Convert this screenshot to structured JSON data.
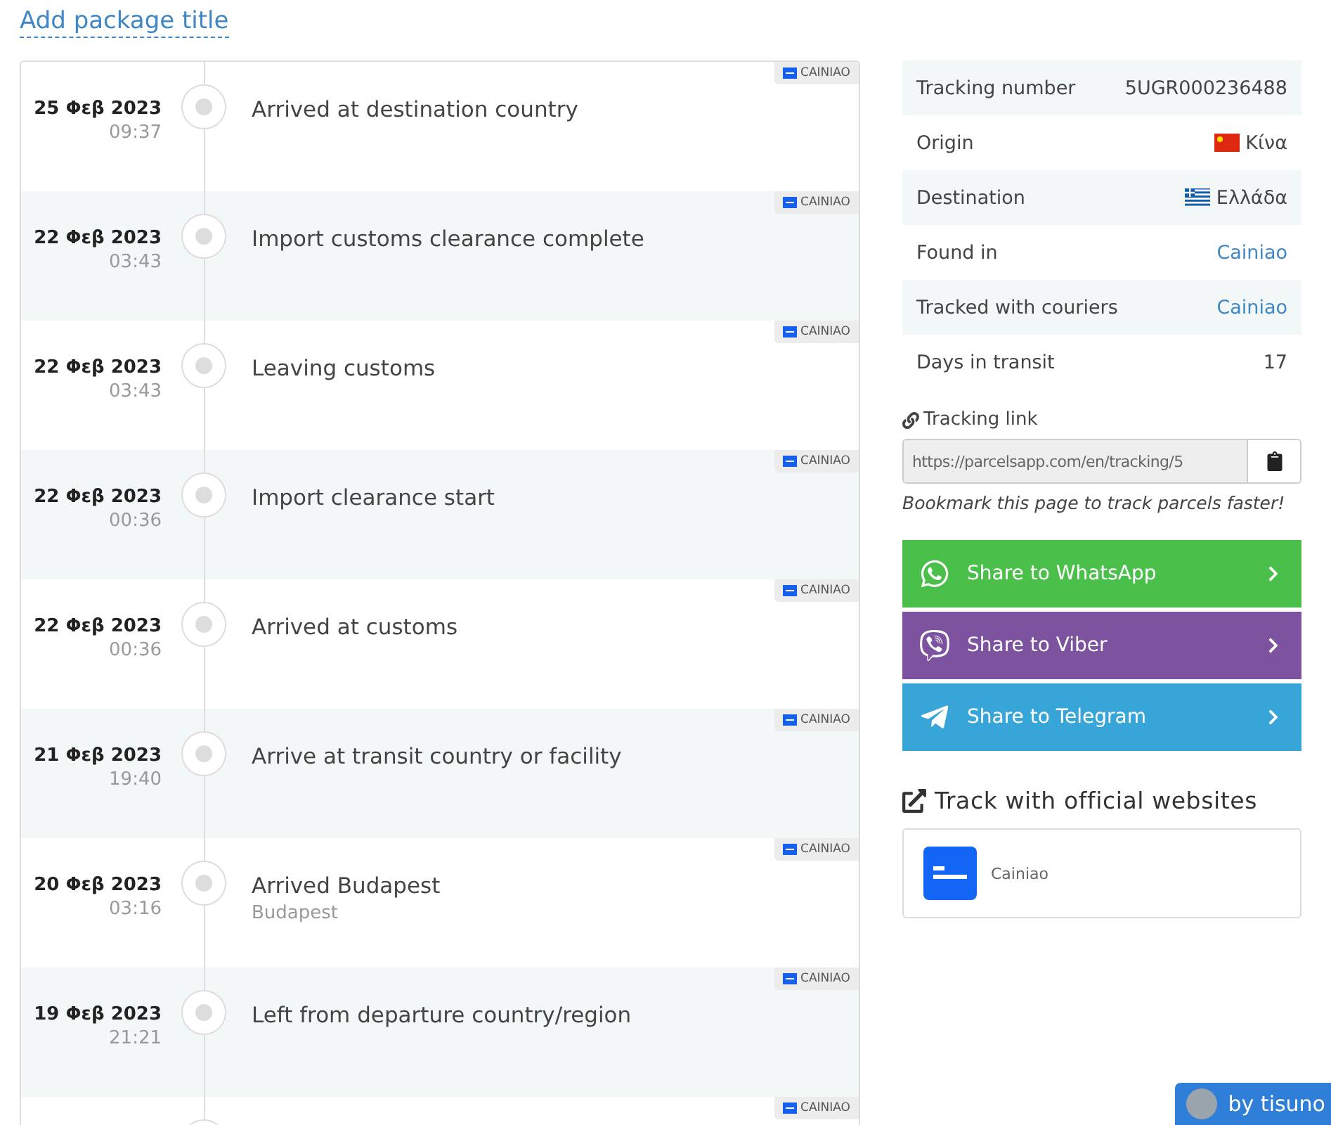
{
  "package_title_link": "Add package title",
  "events": [
    {
      "date": "25 Φεβ 2023",
      "time": "09:37",
      "status": "Arrived at destination country",
      "carrier": "CAINIAO"
    },
    {
      "date": "22 Φεβ 2023",
      "time": "03:43",
      "status": "Import customs clearance complete",
      "carrier": "CAINIAO"
    },
    {
      "date": "22 Φεβ 2023",
      "time": "03:43",
      "status": "Leaving customs",
      "carrier": "CAINIAO"
    },
    {
      "date": "22 Φεβ 2023",
      "time": "00:36",
      "status": "Import clearance start",
      "carrier": "CAINIAO"
    },
    {
      "date": "22 Φεβ 2023",
      "time": "00:36",
      "status": "Arrived at customs",
      "carrier": "CAINIAO"
    },
    {
      "date": "21 Φεβ 2023",
      "time": "19:40",
      "status": "Arrive at transit country or facility",
      "carrier": "CAINIAO"
    },
    {
      "date": "20 Φεβ 2023",
      "time": "03:16",
      "status": "Arrived Budapest",
      "location": "Budapest",
      "carrier": "CAINIAO"
    },
    {
      "date": "19 Φεβ 2023",
      "time": "21:21",
      "status": "Left from departure country/region",
      "carrier": "CAINIAO"
    },
    {
      "carrier": "CAINIAO"
    }
  ],
  "info": [
    {
      "label": "Tracking number",
      "value": "5UGR000236488",
      "kind": "text"
    },
    {
      "label": "Origin",
      "value": "Κίνα",
      "kind": "chinaflag"
    },
    {
      "label": "Destination",
      "value": "Ελλάδα",
      "kind": "greeceflag"
    },
    {
      "label": "Found in",
      "value": "Cainiao",
      "kind": "link"
    },
    {
      "label": "Tracked with couriers",
      "value": "Cainiao",
      "kind": "link"
    },
    {
      "label": "Days in transit",
      "value": "17",
      "kind": "text"
    }
  ],
  "tracking_link": {
    "label": "Tracking link",
    "value": "https://parcelsapp.com/en/tracking/5",
    "hint": "Bookmark this page to track parcels faster!"
  },
  "share": [
    {
      "label": "Share to WhatsApp",
      "kind": "whatsapp",
      "color": "#4ac04a"
    },
    {
      "label": "Share to Viber",
      "kind": "viber",
      "color": "#7d529e"
    },
    {
      "label": "Share to Telegram",
      "kind": "telegram",
      "color": "#38a5d8"
    }
  ],
  "official": {
    "title": "Track with official websites",
    "sites": [
      {
        "name": "Cainiao"
      }
    ]
  },
  "author_badge": "by tisuno"
}
